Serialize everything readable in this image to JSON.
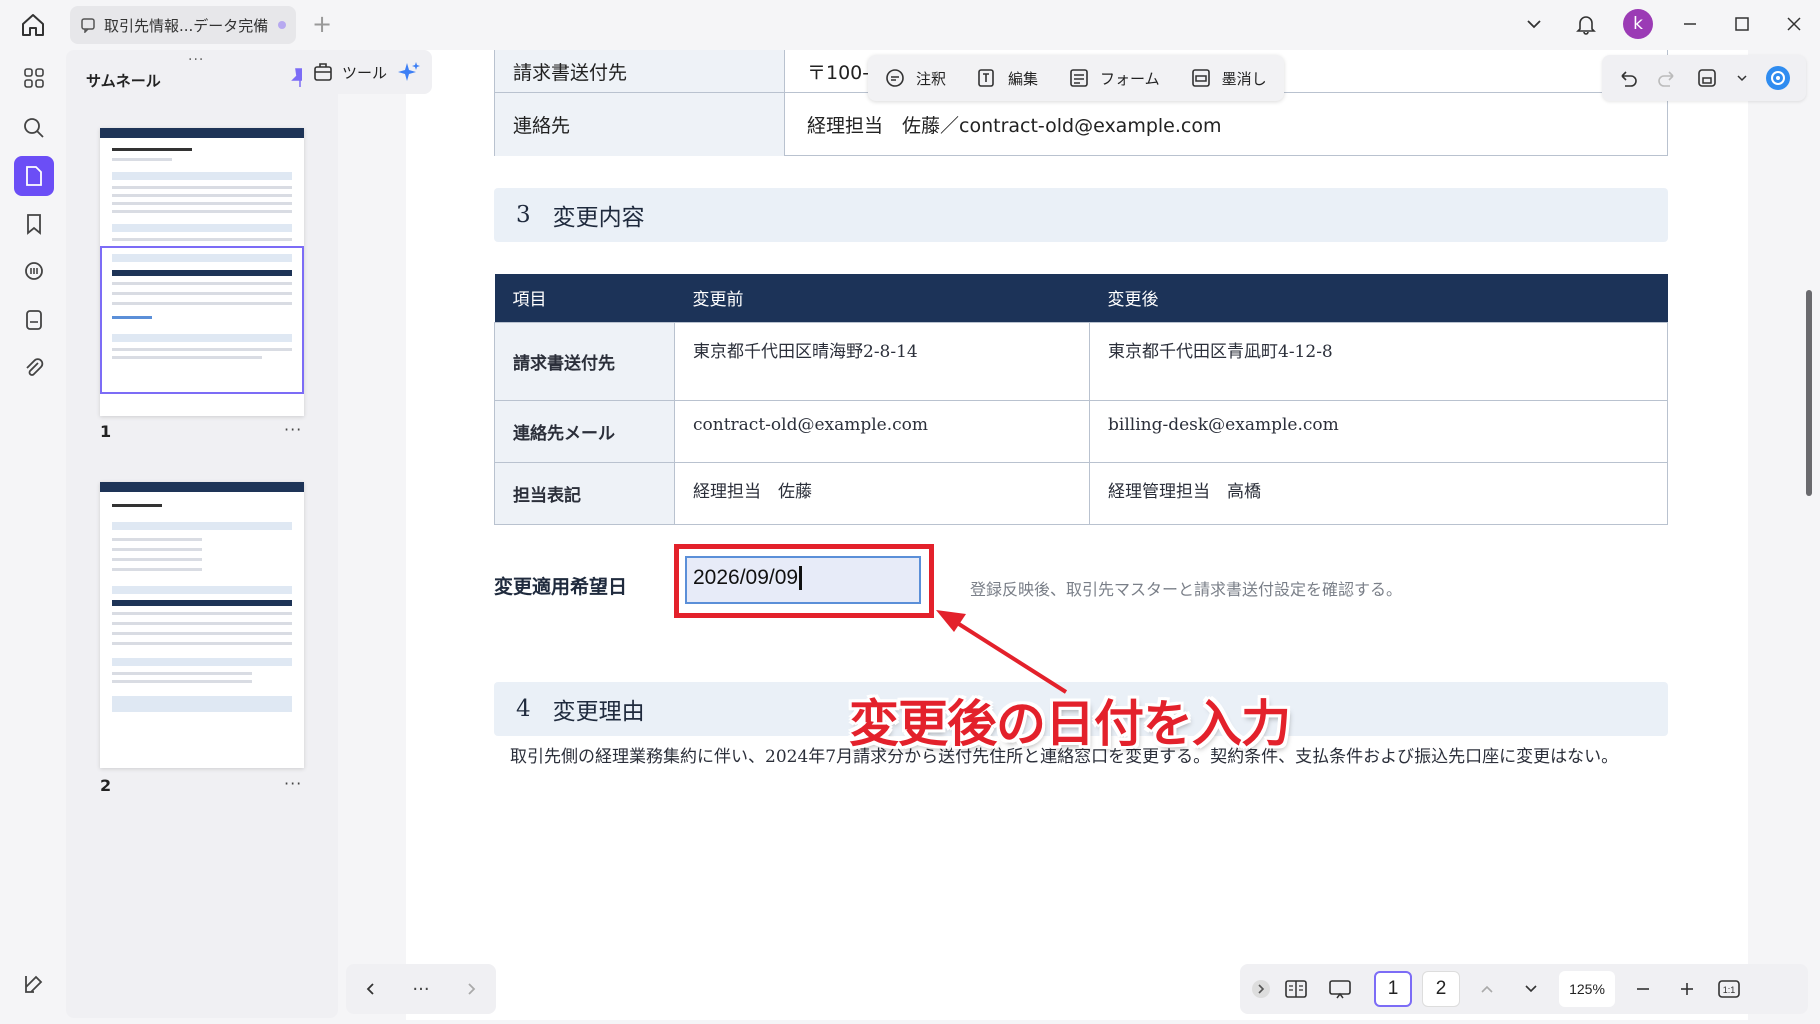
{
  "window": {
    "tab_title": "取引先情報...データ完備",
    "avatar_letter": "k"
  },
  "sidebar": {
    "panel_title": "サムネール",
    "grip": "···",
    "pages": [
      {
        "number": "1",
        "more": "···"
      },
      {
        "number": "2",
        "more": "···"
      }
    ]
  },
  "toolbar": {
    "tools_label": "ツール",
    "modes": [
      {
        "label": "注釈",
        "icon": "comment-icon"
      },
      {
        "label": "編集",
        "icon": "edit-text-icon"
      },
      {
        "label": "フォーム",
        "icon": "form-icon"
      },
      {
        "label": "墨消し",
        "icon": "redact-icon"
      }
    ]
  },
  "document": {
    "top_rows": [
      {
        "label": "請求書送付先",
        "value": "〒100-0"
      },
      {
        "label": "連絡先",
        "value": "経理担当　佐藤／contract-old@example.com"
      }
    ],
    "section3": {
      "num": "3",
      "title": "変更内容"
    },
    "change_table": {
      "headers": [
        "項目",
        "変更前",
        "変更後"
      ],
      "rows": [
        {
          "item": "請求書送付先",
          "before": "東京都千代田区晴海野2-8-14",
          "after": "東京都千代田区青凪町4-12-8"
        },
        {
          "item": "連絡先メール",
          "before": "contract-old@example.com",
          "after": "billing-desk@example.com"
        },
        {
          "item": "担当表記",
          "before": "経理担当　佐藤",
          "after": "経理管理担当　高橋"
        }
      ]
    },
    "apply_date": {
      "label": "変更適用希望日",
      "value": "2026/09/09",
      "note": "登録反映後、取引先マスターと請求書送付設定を確認する。"
    },
    "section4": {
      "num": "4",
      "title": "変更理由"
    },
    "reason_text": "取引先側の経理業務集約に伴い、2024年7月請求分から送付先住所と連絡窓口を変更する。契約条件、支払条件および振込先口座に変更はない。"
  },
  "annotation": {
    "callout": "変更後の日付を入力",
    "color": "#e3212b"
  },
  "bottom": {
    "nav_more": "···",
    "pages": [
      "1",
      "2"
    ],
    "current_page": "1",
    "zoom": "125%",
    "fit_label": "1:1"
  },
  "colors": {
    "accent": "#6b4ef6",
    "table_header": "#1c3358",
    "highlight_red": "#e3212b"
  }
}
